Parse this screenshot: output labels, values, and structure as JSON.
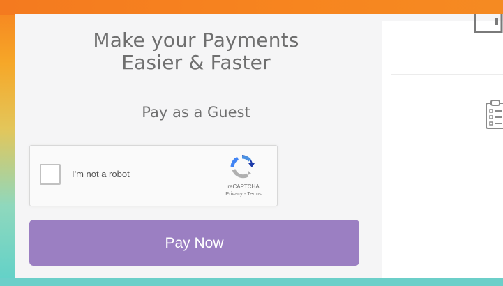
{
  "promo": {
    "headline_line1": "Make your Payments",
    "headline_line2": "Easier & Faster",
    "subhead": "Pay as a Guest"
  },
  "captcha": {
    "label": "I'm not a robot",
    "brand": "reCAPTCHA",
    "links": "Privacy - Terms",
    "checked": false,
    "logo_icon": "recaptcha-logo-icon"
  },
  "actions": {
    "pay_now_label": "Pay Now"
  },
  "icons": {
    "top_icon": "document-icon",
    "clipboard_icon": "clipboard-checklist-icon"
  },
  "colors": {
    "button": "#9b7fc2",
    "text": "#6f6f6f",
    "frame_top": "#f7801f",
    "frame_bottom": "#5fd1c9"
  }
}
